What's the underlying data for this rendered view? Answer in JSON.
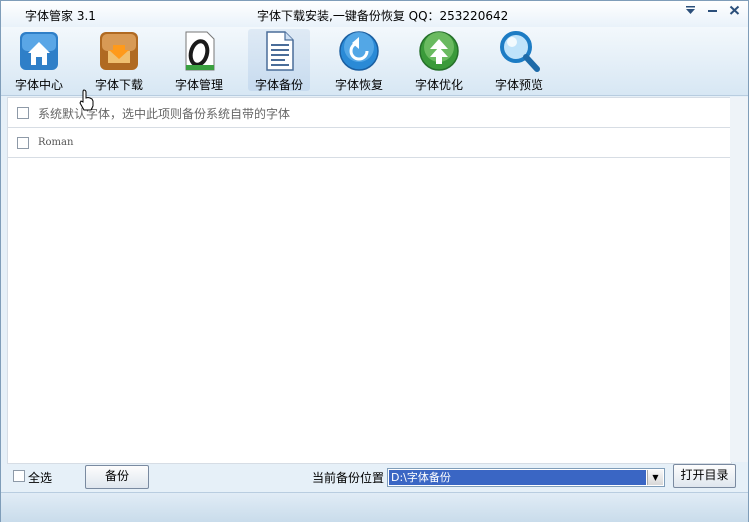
{
  "window": {
    "app_title": "字体管家 3.1",
    "banner": "字体下载安装,一键备份恢复 QQ：253220642",
    "controls": [
      "dropdown-icon",
      "minimize-icon",
      "close-icon"
    ]
  },
  "toolbar": {
    "items": [
      {
        "label": "字体中心",
        "icon": "home-icon",
        "active": false
      },
      {
        "label": "字体下载",
        "icon": "download-icon",
        "active": false
      },
      {
        "label": "字体管理",
        "icon": "font-manage-icon",
        "active": false
      },
      {
        "label": "字体备份",
        "icon": "document-icon",
        "active": true
      },
      {
        "label": "字体恢复",
        "icon": "restore-icon",
        "active": false
      },
      {
        "label": "字体优化",
        "icon": "optimize-icon",
        "active": false
      },
      {
        "label": "字体预览",
        "icon": "magnifier-icon",
        "active": false
      }
    ]
  },
  "list": {
    "rows": [
      {
        "text": "系统默认字体，选中此项则备份系统自带的字体",
        "checked": false
      },
      {
        "text": "Roman",
        "checked": false
      }
    ]
  },
  "bottom": {
    "select_all": "全选",
    "backup_button": "备份",
    "location_label": "当前备份位置",
    "location_value": "D:\\字体备份",
    "open_dir_button": "打开目录"
  },
  "colors": {
    "selection": "#3a66c4",
    "toolbar_bg": "#d7e7f4",
    "border": "#7f9db9"
  }
}
